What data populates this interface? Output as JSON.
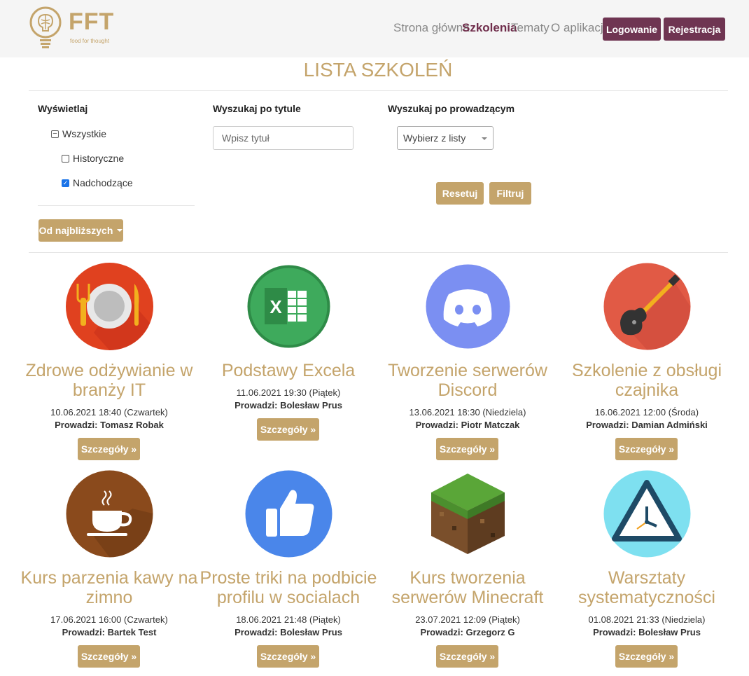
{
  "header": {
    "logo_text": "FFT",
    "logo_sub": "food for thought",
    "nav": [
      {
        "label": "Strona główna"
      },
      {
        "label": "Szkolenia"
      },
      {
        "label": "Tematy"
      },
      {
        "label": "O aplikacji"
      }
    ],
    "login_label": "Logowanie",
    "register_label": "Rejestracja"
  },
  "page_title": "LISTA SZKOLEŃ",
  "filters": {
    "display_label": "Wyświetlaj",
    "options": [
      {
        "label": "Wszystkie",
        "state": "indeterminate"
      },
      {
        "label": "Historyczne",
        "state": "unchecked"
      },
      {
        "label": "Nadchodzące",
        "state": "checked"
      }
    ],
    "title_search_label": "Wyszukaj po tytule",
    "title_placeholder": "Wpisz tytuł",
    "leader_search_label": "Wyszukaj po prowadzącym",
    "leader_select_value": "Wybierz z listy",
    "reset_label": "Resetuj",
    "filter_label": "Filtruj",
    "sort_label": "Od najbliższych"
  },
  "courses": [
    {
      "title": "Zdrowe odżywianie w branży IT",
      "date": "10.06.2021 18:40 (Czwartek)",
      "leader": "Prowadzi: Tomasz Robak",
      "details": "Szczegóły »",
      "icon": "plate-cutlery-icon"
    },
    {
      "title": "Podstawy Excela",
      "date": "11.06.2021 19:30 (Piątek)",
      "leader": "Prowadzi: Bolesław Prus",
      "details": "Szczegóły »",
      "icon": "excel-icon"
    },
    {
      "title": "Tworzenie serwerów Discord",
      "date": "13.06.2021 18:30 (Niedziela)",
      "leader": "Prowadzi: Piotr Matczak",
      "details": "Szczegóły »",
      "icon": "discord-icon"
    },
    {
      "title": "Szkolenie z obsługi czajnika",
      "date": "16.06.2021 12:00 (Środa)",
      "leader": "Prowadzi: Damian Admiński",
      "details": "Szczegóły »",
      "icon": "guitar-icon"
    },
    {
      "title": "Kurs parzenia kawy na zimno",
      "date": "17.06.2021 16:00 (Czwartek)",
      "leader": "Prowadzi: Bartek Test",
      "details": "Szczegóły »",
      "icon": "coffee-cup-icon"
    },
    {
      "title": "Proste triki na podbicie profilu w socialach",
      "date": "18.06.2021 21:48 (Piątek)",
      "leader": "Prowadzi: Bolesław Prus",
      "details": "Szczegóły »",
      "icon": "thumbs-up-icon"
    },
    {
      "title": "Kurs tworzenia serwerów Minecraft",
      "date": "23.07.2021 12:09 (Piątek)",
      "leader": "Prowadzi: Grzegorz G",
      "details": "Szczegóły »",
      "icon": "minecraft-block-icon"
    },
    {
      "title": "Warsztaty systematyczności",
      "date": "01.08.2021 21:33 (Niedziela)",
      "leader": "Prowadzi: Bolesław Prus",
      "details": "Szczegóły »",
      "icon": "clock-icon"
    }
  ],
  "colors": {
    "gold": "#c4a46b",
    "plum": "#6f3552"
  }
}
